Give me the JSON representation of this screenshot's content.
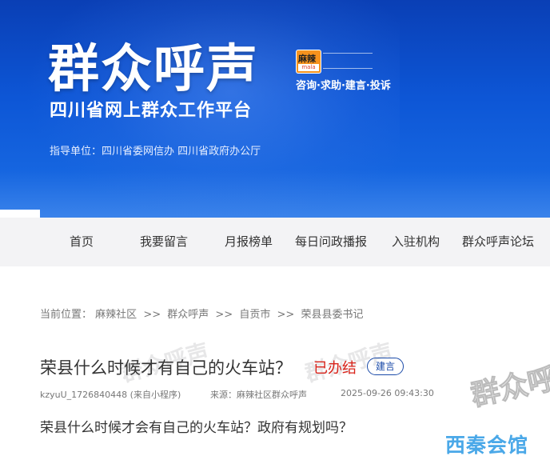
{
  "banner": {
    "title": "群众呼声",
    "subtitle": "四川省网上群众工作平台",
    "guide": "指导单位：四川省委网信办  四川省政府办公厅",
    "logo_text": "麻辣",
    "slogan": "咨询·求助·建言·投诉"
  },
  "nav": {
    "items": [
      "首页",
      "我要留言",
      "月报榜单",
      "每日问政播报",
      "入驻机构",
      "群众呼声论坛"
    ]
  },
  "breadcrumb": {
    "prefix": "当前位置：",
    "items": [
      "麻辣社区",
      "群众呼声",
      "自贡市",
      "荣县县委书记"
    ],
    "separator": ">>"
  },
  "post": {
    "title": "荣县什么时候才有自己的火车站？",
    "status": "已办结",
    "tag": "建言",
    "author": "kzyuU_1726840448 (来自小程序)",
    "source": "来源：麻辣社区群众呼声",
    "datetime": "2025-09-26 09:43:30",
    "content": "荣县什么时候才会有自己的火车站？政府有规划吗？"
  },
  "watermark": {
    "brand_right": "群众呼",
    "brand_bottom": "西秦会馆"
  }
}
